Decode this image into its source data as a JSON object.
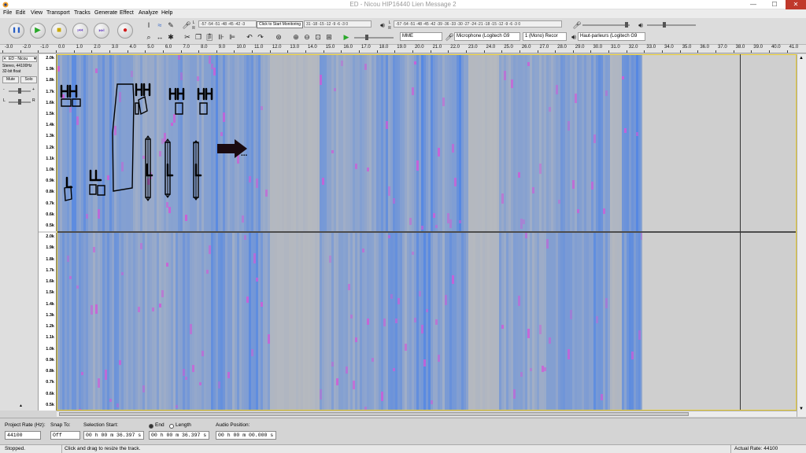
{
  "window": {
    "title": "ED - Nicou HIP16440 Lien Message 2",
    "minimize": "—",
    "maximize": "☐",
    "close": "✕"
  },
  "menu": [
    "File",
    "Edit",
    "View",
    "Transport",
    "Tracks",
    "Generate",
    "Effect",
    "Analyze",
    "Help"
  ],
  "transport": {
    "pause": "❚❚",
    "play": "▶",
    "stop": "■",
    "skip_start": "⏮",
    "skip_end": "⏭",
    "record": "●"
  },
  "meters": {
    "record_scale": "-57 -54 -51 -48 -45 -42 -3",
    "monitor_hint": "Click to Start Monitoring",
    "monitor_scale": "31 -18 -15 -12 -9 -6 -3 0",
    "playback_scale": "-57 -54 -51 -48 -45 -42 -39 -36 -33 -30 -27 -24 -21 -18 -15 -12 -9 -6 -3 0",
    "record_letter_l": "L",
    "record_letter_r": "R",
    "play_letter_l": "L",
    "play_letter_r": "R"
  },
  "devices": {
    "host": "MME",
    "microphone": "Microphone (Logitech G9",
    "channels": "1 (Mono) Recor",
    "speakers": "Haut-parleurs (Logitech G9"
  },
  "ruler": [
    "-3.0",
    "-2.0",
    "-1.0",
    "0.0",
    "1.0",
    "2.0",
    "3.0",
    "4.0",
    "5.0",
    "6.0",
    "7.0",
    "8.0",
    "9.0",
    "10.0",
    "11.0",
    "12.0",
    "13.0",
    "14.0",
    "15.0",
    "16.0",
    "17.0",
    "18.0",
    "19.0",
    "20.0",
    "21.0",
    "22.0",
    "23.0",
    "24.0",
    "25.0",
    "26.0",
    "27.0",
    "28.0",
    "29.0",
    "30.0",
    "31.0",
    "32.0",
    "33.0",
    "34.0",
    "35.0",
    "36.0",
    "37.0",
    "38.0",
    "39.0",
    "40.0",
    "41.0"
  ],
  "track": {
    "name": "ED - Nicou",
    "close": "✕",
    "menu_arrow": "▼",
    "info1": "Stereo, 44100Hz",
    "info2": "32-bit float",
    "mute": "Mute",
    "solo": "Solo",
    "gain_minus": "-",
    "gain_plus": "+",
    "pan_l": "L",
    "pan_r": "R",
    "collapse": "▲"
  },
  "freq_labels": [
    "2.0k",
    "1.9k",
    "1.8k",
    "1.7k",
    "1.6k",
    "1.5k",
    "1.4k",
    "1.3k",
    "1.2k",
    "1.1k",
    "1.0k",
    "0.9k",
    "0.8k",
    "0.7k",
    "0.6k",
    "0.5k"
  ],
  "annotations": {
    "arrow_dots": "..."
  },
  "selection_toolbar": {
    "project_rate_label": "Project Rate (Hz):",
    "project_rate": "44100",
    "snap_label": "Snap To:",
    "snap_value": "Off",
    "selection_start_label": "Selection Start:",
    "selection_start": "00 h 00 m 36.397 s",
    "end_label": "End",
    "length_label": "Length",
    "end_value": "00 h 00 m 36.397 s",
    "audio_position_label": "Audio Position:",
    "audio_position": "00 h 00 m 00.000 s"
  },
  "status": {
    "state": "Stopped.",
    "hint": "Click and drag to resize the track.",
    "rate": "Actual Rate: 44100"
  },
  "colors": {
    "spectro_base": "#bdbdbd",
    "spectro_blue": "#4a82e6",
    "spectro_magenta": "#d05ad8",
    "selection_border": "#e8cc2e"
  }
}
